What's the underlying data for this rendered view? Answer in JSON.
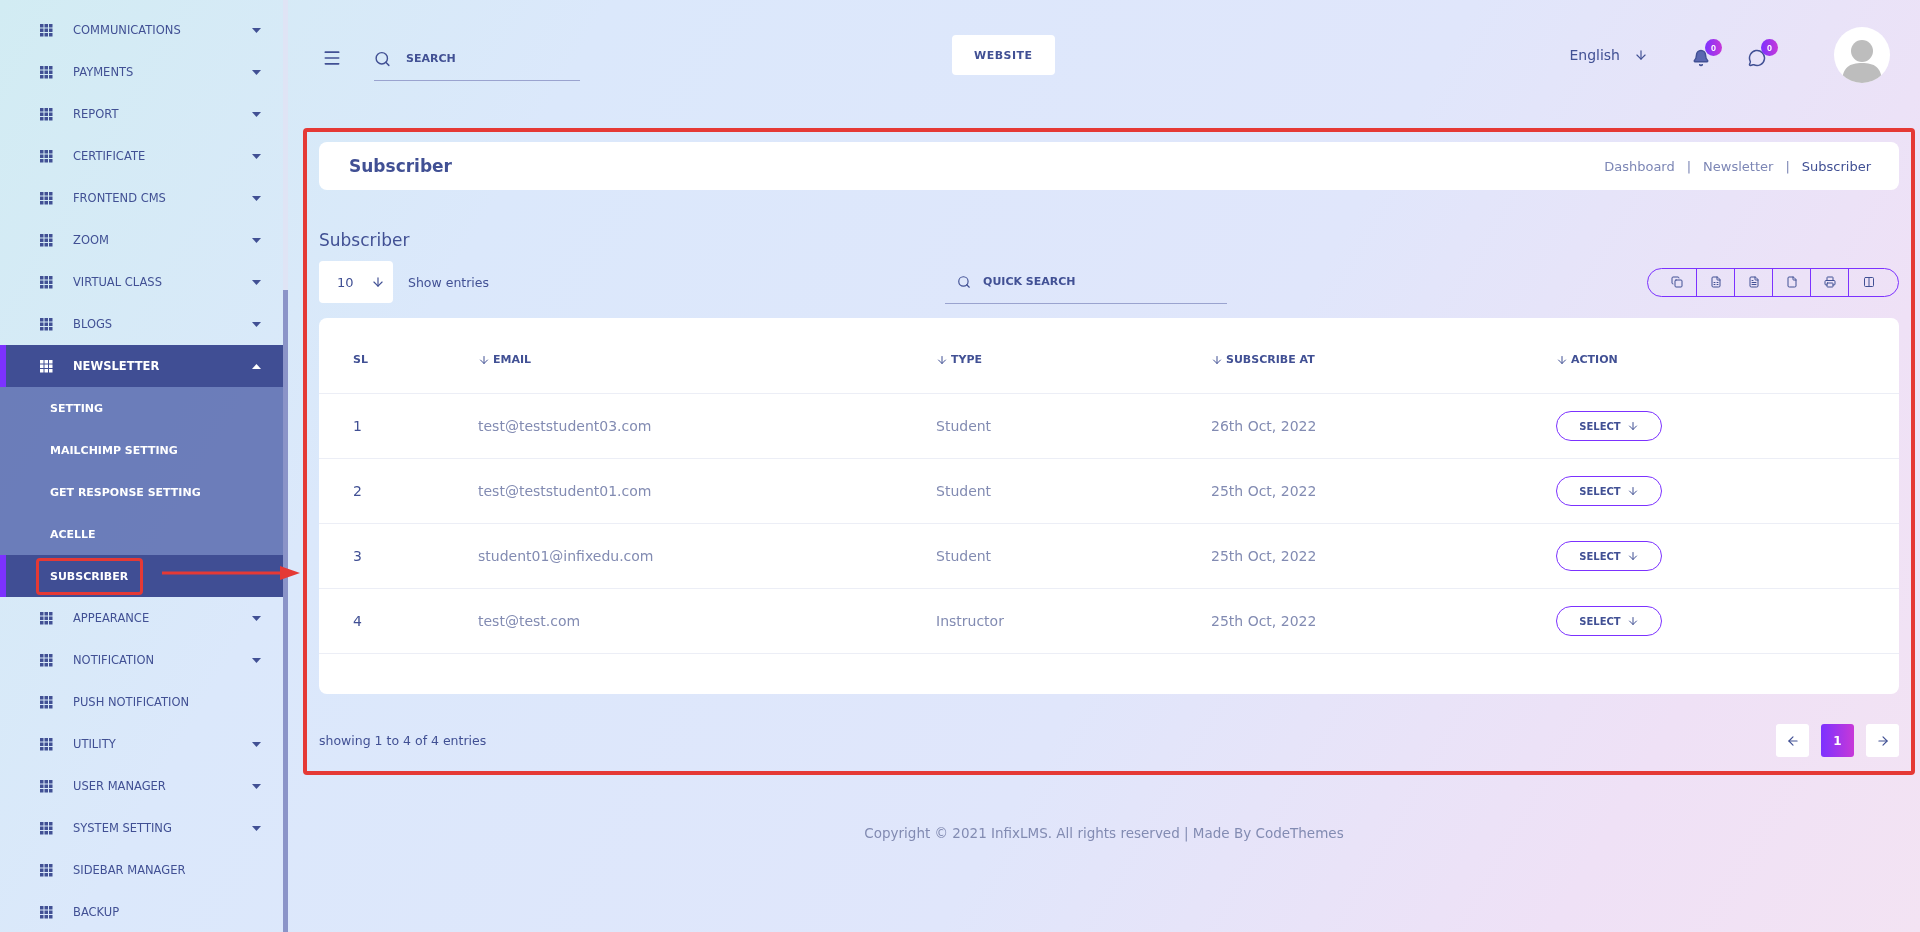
{
  "sidebar": {
    "items": [
      {
        "label": "COMMUNICATIONS",
        "expandable": true,
        "expanded": false,
        "selected": false
      },
      {
        "label": "PAYMENTS",
        "expandable": true,
        "expanded": false,
        "selected": false
      },
      {
        "label": "REPORT",
        "expandable": true,
        "expanded": false,
        "selected": false
      },
      {
        "label": "CERTIFICATE",
        "expandable": true,
        "expanded": false,
        "selected": false
      },
      {
        "label": "FRONTEND CMS",
        "expandable": true,
        "expanded": false,
        "selected": false
      },
      {
        "label": "ZOOM",
        "expandable": true,
        "expanded": false,
        "selected": false
      },
      {
        "label": "VIRTUAL CLASS",
        "expandable": true,
        "expanded": false,
        "selected": false
      },
      {
        "label": "BLOGS",
        "expandable": true,
        "expanded": false,
        "selected": false
      },
      {
        "label": "NEWSLETTER",
        "expandable": true,
        "expanded": true,
        "selected": true,
        "children": [
          {
            "label": "SETTING",
            "selected": false,
            "highlighted": false
          },
          {
            "label": "MAILCHIMP SETTING",
            "selected": false,
            "highlighted": false
          },
          {
            "label": "GET RESPONSE SETTING",
            "selected": false,
            "highlighted": false
          },
          {
            "label": "ACELLE",
            "selected": false,
            "highlighted": false
          },
          {
            "label": "SUBSCRIBER",
            "selected": true,
            "highlighted": true
          }
        ]
      },
      {
        "label": "APPEARANCE",
        "expandable": true,
        "expanded": false,
        "selected": false
      },
      {
        "label": "NOTIFICATION",
        "expandable": true,
        "expanded": false,
        "selected": false
      },
      {
        "label": "PUSH NOTIFICATION",
        "expandable": false,
        "selected": false
      },
      {
        "label": "UTILITY",
        "expandable": true,
        "expanded": false,
        "selected": false
      },
      {
        "label": "USER MANAGER",
        "expandable": true,
        "expanded": false,
        "selected": false
      },
      {
        "label": "SYSTEM SETTING",
        "expandable": true,
        "expanded": false,
        "selected": false
      },
      {
        "label": "SIDEBAR MANAGER",
        "expandable": false,
        "selected": false
      },
      {
        "label": "BACKUP",
        "expandable": false,
        "selected": false
      }
    ]
  },
  "topbar": {
    "search": {
      "placeholder": "SEARCH"
    },
    "website_button": "WEBSITE",
    "language": "English",
    "notifications": {
      "count": "0"
    },
    "messages": {
      "count": "0"
    }
  },
  "header": {
    "title": "Subscriber",
    "breadcrumbs": [
      {
        "label": "Dashboard",
        "selected": false
      },
      {
        "separator": "|",
        "label": "Newsletter",
        "selected": false
      },
      {
        "separator": "|",
        "label": "Subscriber",
        "selected": true
      }
    ]
  },
  "section_title": "Subscriber",
  "entries": {
    "value": "10",
    "label": "Show entries"
  },
  "quick_search": {
    "placeholder": "QUICK SEARCH"
  },
  "table": {
    "columns": [
      {
        "label": "SL",
        "sortable": false
      },
      {
        "label": "EMAIL",
        "sortable": true
      },
      {
        "label": "TYPE",
        "sortable": true
      },
      {
        "label": "SUBSCRIBE AT",
        "sortable": true
      },
      {
        "label": "ACTION",
        "sortable": true
      }
    ],
    "rows": [
      {
        "sl": "1",
        "email": "test@teststudent03.com",
        "type": "Student",
        "subscribe_at": "26th Oct, 2022",
        "action": "SELECT"
      },
      {
        "sl": "2",
        "email": "test@teststudent01.com",
        "type": "Student",
        "subscribe_at": "25th Oct, 2022",
        "action": "SELECT"
      },
      {
        "sl": "3",
        "email": "student01@infixedu.com",
        "type": "Student",
        "subscribe_at": "25th Oct, 2022",
        "action": "SELECT"
      },
      {
        "sl": "4",
        "email": "test@test.com",
        "type": "Instructor",
        "subscribe_at": "25th Oct, 2022",
        "action": "SELECT"
      }
    ]
  },
  "footer": {
    "info": "showing 1 to 4 of 4 entries",
    "pages": [
      {
        "label": "1",
        "selected": true
      }
    ]
  },
  "copyright": "Copyright © 2021 InfixLMS. All rights reserved | Made By CodeThemes"
}
